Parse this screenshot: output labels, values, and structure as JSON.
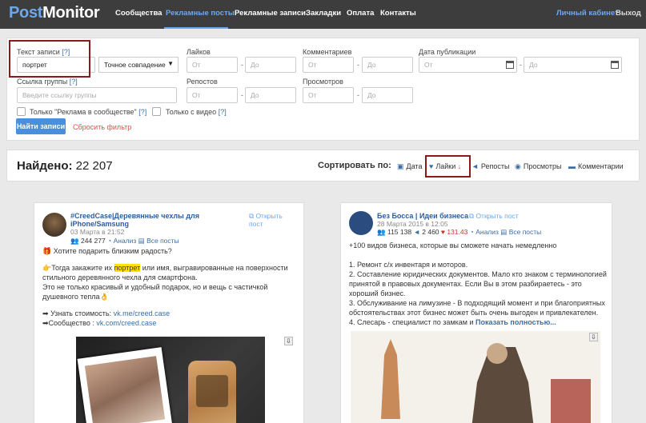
{
  "nav": {
    "logo_post": "Post",
    "logo_monitor": "Monitor",
    "items": [
      "Сообщества",
      "Рекламные посты",
      "Рекламные записи",
      "Закладки",
      "Оплата",
      "Контакты"
    ],
    "cabinet": "Личный кабинет",
    "exit": "Выход"
  },
  "filters": {
    "text_label": "Текст записи",
    "help": "[?]",
    "text_value": "портрет",
    "match_select": "Точное совпадение",
    "likes_label": "Лайков",
    "comments_label": "Комментариев",
    "pubdate_label": "Дата публикации",
    "from": "От",
    "to": "До",
    "dash": "-",
    "group_link_label": "Ссылка группы",
    "group_link_placeholder": "Введите ссылку группы",
    "reposts_label": "Репостов",
    "views_label": "Просмотров",
    "ads_only_label": "Только \"Реклама в сообществе\"",
    "video_only_label": "Только с видео",
    "find_button": "Найти записи",
    "reset_link": "Сбросить фильтр"
  },
  "results": {
    "found_label": "Найдено:",
    "found_count": "22 207",
    "sort_label": "Сортировать по:",
    "sort_options": [
      "Дата",
      "Лайки",
      "Репосты",
      "Просмотры",
      "Комментарии"
    ],
    "sort_arrow": "↓"
  },
  "posts": [
    {
      "title": "#CreedCase|Деревянные чехлы для iPhone/Samsung",
      "date": "03 Марта в 21:52",
      "members": "244 277",
      "analysis": "Анализ",
      "all_posts": "Все посты",
      "open_post": "Открыть пост",
      "lines": [
        "Хотите подарить близким радость?",
        "Тогда закажите их",
        "портрет",
        "или имя, выгравированные на поверхности стильного деревянного чехла для смартфона.",
        "Это не только красивый и удобный подарок, но и вещь с частичкой душевного тепла",
        "Узнать стоимость:",
        "vk.me/creed.case",
        "Сообщество :",
        "vk.com/creed.case"
      ]
    },
    {
      "title": "Без Босса | Идеи бизнеса",
      "date": "28 Марта 2015 в 12:05",
      "members": "115 138",
      "reposts": "2 460",
      "likes": "131.43",
      "analysis": "Анализ",
      "all_posts": "Все посты",
      "open_post": "Открыть пост",
      "lines": [
        "+100 видов бизнеса, которые вы сможете начать немедленно",
        "1. Ремонт с/х инвентаря и моторов.",
        "2. Составление юридических документов. Мало кто знаком с терминологией принятой в правовых документах. Если Вы в этом разбираетесь - это хороший бизнес.",
        "3. Обслуживание на лимузине - В подходящий момент и при благоприятных обстоятельствах этот бизнес может быть очень выгоден и привлекателен.",
        "4. Слесарь - специалист по замкам и",
        "Показать полностью..."
      ]
    }
  ],
  "colors": {
    "nav_bg": "#3d3d3d",
    "accent": "#6fa8ea",
    "button": "#4a8fdb",
    "reset": "#d9534f",
    "highlight": "#ffe200",
    "annotation_box": "#8b1a1a"
  }
}
